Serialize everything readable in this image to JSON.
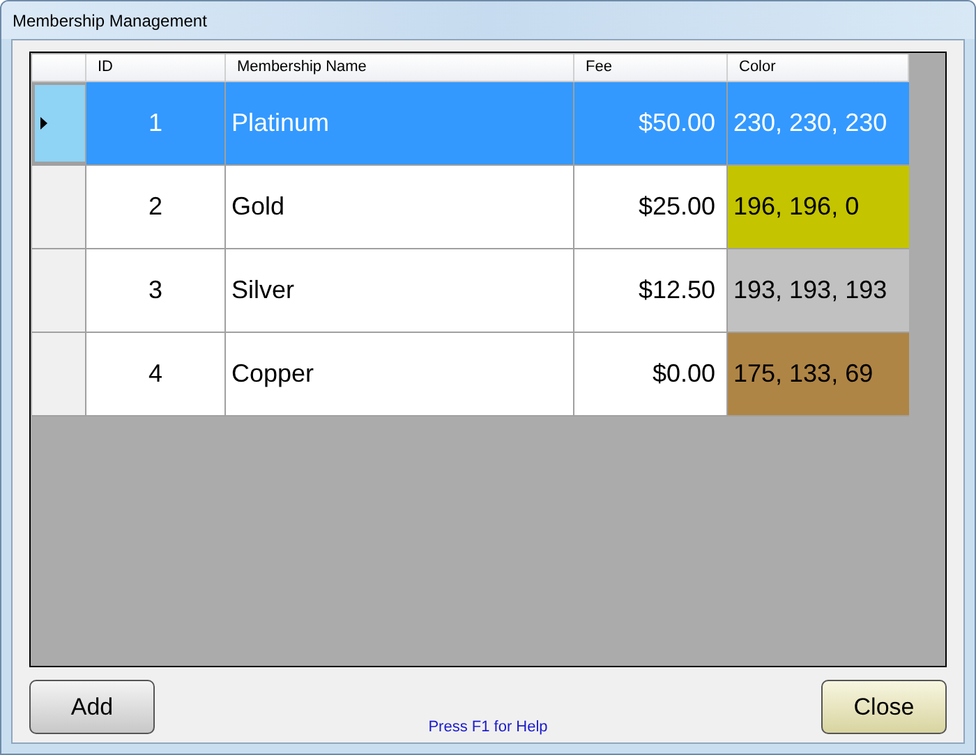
{
  "window": {
    "title": "Membership Management"
  },
  "table": {
    "columns": [
      "ID",
      "Membership Name",
      "Fee",
      "Color"
    ],
    "rows": [
      {
        "id": "1",
        "name": "Platinum",
        "fee": "$50.00",
        "color_text": "230, 230, 230",
        "selected": true
      },
      {
        "id": "2",
        "name": "Gold",
        "fee": "$25.00",
        "color_text": "196, 196, 0",
        "color": "#c4c400",
        "selected": false
      },
      {
        "id": "3",
        "name": "Silver",
        "fee": "$12.50",
        "color_text": "193, 193, 193",
        "color": "#c1c1c1",
        "selected": false
      },
      {
        "id": "4",
        "name": "Copper",
        "fee": "$0.00",
        "color_text": "175, 133, 69",
        "color": "#af8545",
        "selected": false
      }
    ]
  },
  "buttons": {
    "add": "Add",
    "close": "Close"
  },
  "status": "Press F1 for Help"
}
